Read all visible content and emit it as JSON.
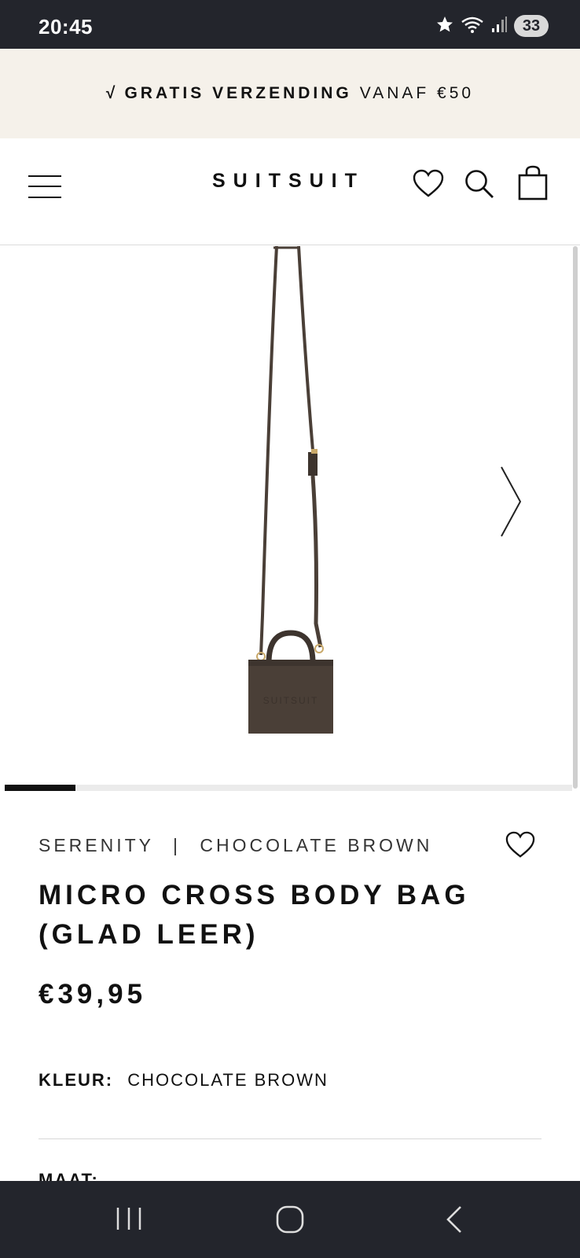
{
  "status_bar": {
    "time": "20:45",
    "battery": "33",
    "icons": [
      "star-icon",
      "wifi-icon",
      "signal-icon",
      "battery-icon"
    ]
  },
  "promo": {
    "check": "√",
    "bold": "GRATIS VERZENDING",
    "rest": "VANAF €50"
  },
  "header": {
    "logo": "SUITSUIT",
    "icons": [
      "menu-icon",
      "heart-icon",
      "search-icon",
      "bag-icon"
    ]
  },
  "gallery": {
    "current_image": 1,
    "image_count": 8,
    "image_description_icon": "bag-product-image",
    "bag_imprint": "SUITSUIT"
  },
  "product": {
    "collection": "SERENITY",
    "separator": "|",
    "color_name": "CHOCOLATE BROWN",
    "title": "MICRO CROSS BODY BAG (GLAD LEER)",
    "price": "€39,95",
    "color_label": "KLEUR:",
    "color_value": "CHOCOLATE BROWN",
    "size_label": "MAAT:"
  },
  "colors": {
    "system_bar": "#23252c",
    "promo_bg": "#f5f1ea",
    "bag_brown": "#4a3f37",
    "text": "#111111"
  },
  "nav_bar": {
    "icons": [
      "recents-icon",
      "home-icon",
      "back-icon"
    ]
  }
}
